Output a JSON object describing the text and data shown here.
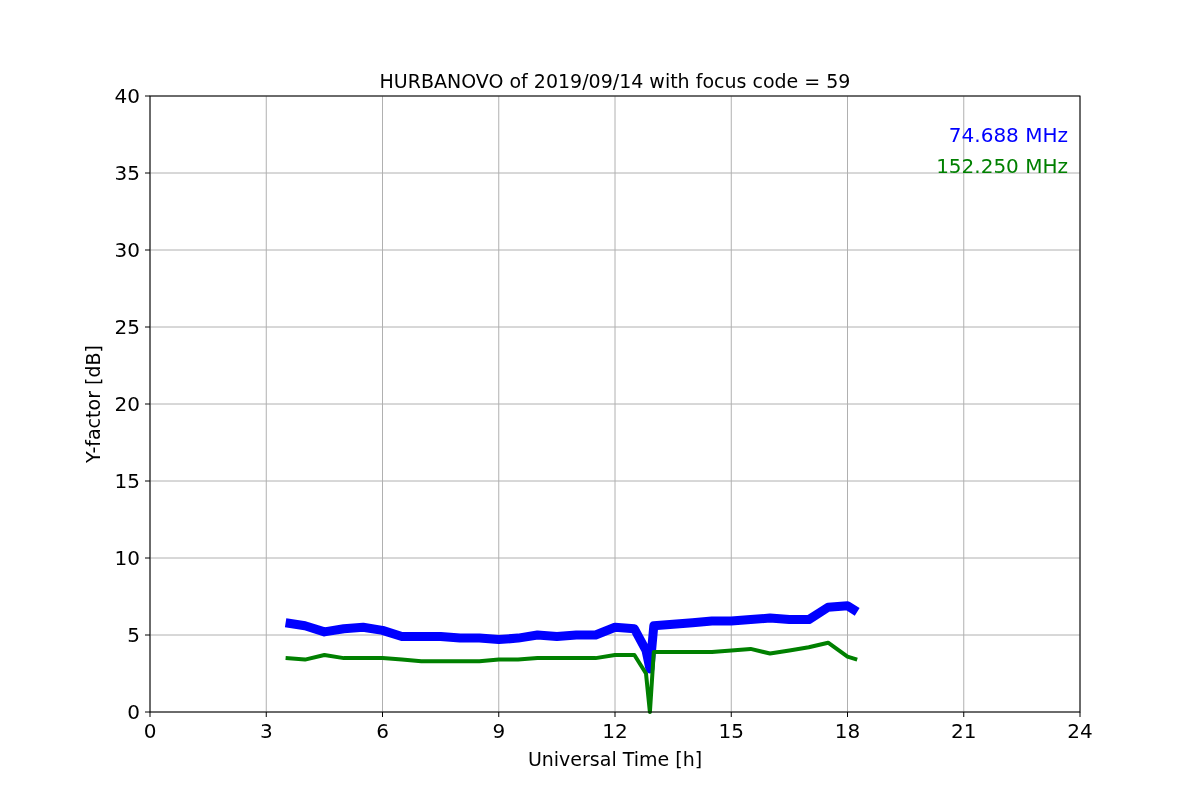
{
  "chart": {
    "chart_data": {
      "type": "line",
      "title": "HURBANOVO of 2019/09/14 with focus code = 59",
      "xlabel": "Universal Time [h]",
      "ylabel": "Y-factor [dB]",
      "x": [
        3.5,
        4.0,
        4.5,
        5.0,
        5.5,
        6.0,
        6.5,
        7.0,
        7.5,
        8.0,
        8.5,
        9.0,
        9.5,
        10.0,
        10.5,
        11.0,
        11.5,
        12.0,
        12.5,
        12.8,
        12.9,
        13.0,
        13.5,
        14.0,
        14.5,
        15.0,
        15.5,
        16.0,
        16.5,
        17.0,
        17.5,
        18.0,
        18.25
      ],
      "series": [
        {
          "name": "74.688 MHz",
          "color": "#0000ff",
          "values": [
            5.8,
            5.6,
            5.2,
            5.4,
            5.5,
            5.3,
            4.9,
            4.9,
            4.9,
            4.8,
            4.8,
            4.7,
            4.8,
            5.0,
            4.9,
            5.0,
            5.0,
            5.5,
            5.4,
            4.0,
            2.8,
            5.6,
            5.7,
            5.8,
            5.9,
            5.9,
            6.0,
            6.1,
            6.0,
            6.0,
            6.8,
            6.9,
            6.5
          ]
        },
        {
          "name": "152.250 MHz",
          "color": "#008000",
          "values": [
            3.5,
            3.4,
            3.7,
            3.5,
            3.5,
            3.5,
            3.4,
            3.3,
            3.3,
            3.3,
            3.3,
            3.4,
            3.4,
            3.5,
            3.5,
            3.5,
            3.5,
            3.7,
            3.7,
            2.5,
            0.0,
            3.9,
            3.9,
            3.9,
            3.9,
            4.0,
            4.1,
            3.8,
            4.0,
            4.2,
            4.5,
            3.6,
            3.4
          ]
        }
      ],
      "xlim": [
        0,
        24
      ],
      "ylim": [
        0,
        40
      ],
      "xticks": [
        0,
        3,
        6,
        9,
        12,
        15,
        18,
        21,
        24
      ],
      "yticks": [
        0,
        5,
        10,
        15,
        20,
        25,
        30,
        35,
        40
      ],
      "grid": true
    }
  }
}
